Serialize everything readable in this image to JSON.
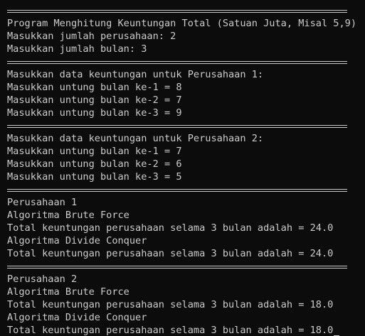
{
  "console": {
    "lines": [
      {
        "type": "separator"
      },
      {
        "type": "text",
        "text": "Program Menghitung Keuntungan Total (Satuan Juta, Misal 5,9)"
      },
      {
        "type": "text",
        "text": "Masukkan jumlah perusahaan: 2"
      },
      {
        "type": "text",
        "text": "Masukkan jumlah bulan: 3"
      },
      {
        "type": "separator"
      },
      {
        "type": "text",
        "text": "Masukkan data keuntungan untuk Perusahaan 1:"
      },
      {
        "type": "text",
        "text": "Masukkan untung bulan ke-1 = 8"
      },
      {
        "type": "text",
        "text": "Masukkan untung bulan ke-2 = 7"
      },
      {
        "type": "text",
        "text": "Masukkan untung bulan ke-3 = 9"
      },
      {
        "type": "separator"
      },
      {
        "type": "text",
        "text": "Masukkan data keuntungan untuk Perusahaan 2:"
      },
      {
        "type": "text",
        "text": "Masukkan untung bulan ke-1 = 7"
      },
      {
        "type": "text",
        "text": "Masukkan untung bulan ke-2 = 6"
      },
      {
        "type": "text",
        "text": "Masukkan untung bulan ke-3 = 5"
      },
      {
        "type": "separator"
      },
      {
        "type": "text",
        "text": "Perusahaan 1"
      },
      {
        "type": "text",
        "text": "Algoritma Brute Force"
      },
      {
        "type": "text",
        "text": "Total keuntungan perusahaan selama 3 bulan adalah = 24.0"
      },
      {
        "type": "text",
        "text": "Algoritma Divide Conquer"
      },
      {
        "type": "text",
        "text": "Total keuntungan perusahaan selama 3 bulan adalah = 24.0"
      },
      {
        "type": "separator"
      },
      {
        "type": "text",
        "text": "Perusahaan 2"
      },
      {
        "type": "text",
        "text": "Algoritma Brute Force"
      },
      {
        "type": "text",
        "text": "Total keuntungan perusahaan selama 3 bulan adalah = 18.0"
      },
      {
        "type": "text",
        "text": "Algoritma Divide Conquer"
      },
      {
        "type": "text",
        "text": "Total keuntungan perusahaan selama 3 bulan adalah = 18.0",
        "cursor": true
      }
    ]
  },
  "colors": {
    "background": "#0c0c0c",
    "foreground": "#cccccc"
  }
}
